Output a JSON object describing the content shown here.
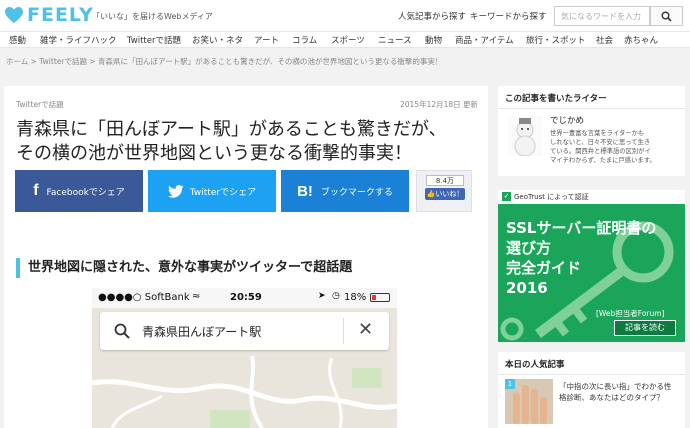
{
  "header": {
    "logo_text": "FEELY",
    "tagline": "「いいな」を届けるWebメディア",
    "links": [
      "人気記事から探す",
      "キーワードから探す"
    ],
    "search_placeholder": "気になるワードを入力",
    "colors": {
      "brand": "#4fc0e8"
    }
  },
  "nav": {
    "items": [
      "感動",
      "雑学・ライフハック",
      "Twitterで話題",
      "お笑い・ネタ",
      "アート",
      "コラム",
      "スポーツ",
      "ニュース",
      "動物",
      "商品・アイテム",
      "旅行・スポット",
      "社会",
      "赤ちゃん"
    ]
  },
  "breadcrumb": {
    "text": "ホーム > Twitterで話題 > 青森県に「田んぼアート駅」があることも驚きだが、その横の池が世界地図という更なる衝撃的事実！"
  },
  "article": {
    "category": "Twitterで話題",
    "date": "2015年12月18日 更新",
    "title_line1": "青森県に「田んぼアート駅」があることも驚きだが、",
    "title_line2": "その横の池が世界地図という更なる衝撃的事実！",
    "share": {
      "facebook": "Facebookでシェア",
      "twitter": "Twitterでシェア",
      "hatena": "ブックマークする",
      "like_count": "8.4万",
      "like_label": "いいね！"
    },
    "section_heading": "世界地図に隠された、意外な事実がツイッターで超話題",
    "phone": {
      "carrier": "●●●●○ SoftBank",
      "time": "20:59",
      "battery": "18%",
      "search_query": "青森県田んぼアート駅"
    }
  },
  "sidebar": {
    "author_box_title": "この記事を書いたライター",
    "author_name": "でじかめ",
    "author_bio_lines": [
      "世界一豊富な言葉をライターかも",
      "しれないと、日々不安に思って生き",
      "ている。関西弁と標準語の区別がイ",
      "マイチわからず、たまに戸惑います。"
    ],
    "ad": {
      "badge": "GeoTrust によって認証",
      "line1": "SSLサーバー証明書の",
      "line2": "選び方",
      "line3": "完全ガイド",
      "line4": "2016",
      "source": "[Web担当者Forum]",
      "cta": "記事を読む"
    },
    "popular_title": "本日の人気記事",
    "popular_items": [
      {
        "rank": "1",
        "text_line1": "「中指の次に長い指」でわかる性",
        "text_line2": "格診断、あなたはどのタイプ？"
      }
    ]
  }
}
